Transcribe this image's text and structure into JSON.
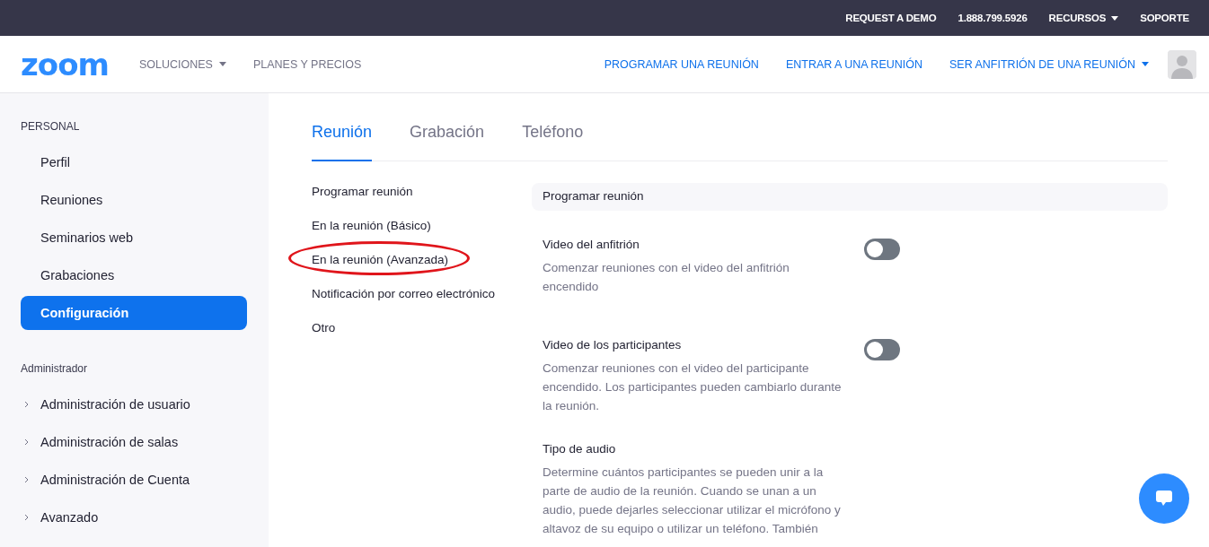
{
  "top_bar": {
    "links": [
      {
        "label": "REQUEST A DEMO",
        "kind": "link"
      },
      {
        "label": "1.888.799.5926",
        "kind": "link"
      },
      {
        "label": "RECURSOS",
        "kind": "dropdown"
      },
      {
        "label": "SOPORTE",
        "kind": "link"
      }
    ]
  },
  "header": {
    "logo": "zoom",
    "nav_left": [
      {
        "label": "SOLUCIONES",
        "kind": "dropdown"
      },
      {
        "label": "PLANES Y PRECIOS",
        "kind": "link"
      }
    ],
    "nav_right": [
      {
        "label": "PROGRAMAR UNA REUNIÓN",
        "kind": "link"
      },
      {
        "label": "ENTRAR A UNA REUNIÓN",
        "kind": "link"
      },
      {
        "label": "SER ANFITRIÓN DE UNA REUNIÓN",
        "kind": "dropdown"
      }
    ]
  },
  "sidebar": {
    "sections": [
      {
        "title": "PERSONAL",
        "items": [
          {
            "label": "Perfil",
            "selected": false,
            "expandable": false
          },
          {
            "label": "Reuniones",
            "selected": false,
            "expandable": false
          },
          {
            "label": "Seminarios web",
            "selected": false,
            "expandable": false
          },
          {
            "label": "Grabaciones",
            "selected": false,
            "expandable": false
          },
          {
            "label": "Configuración",
            "selected": true,
            "expandable": false
          }
        ]
      },
      {
        "title": "Administrador",
        "items": [
          {
            "label": "Administración de usuario",
            "selected": false,
            "expandable": true
          },
          {
            "label": "Administración de salas",
            "selected": false,
            "expandable": true
          },
          {
            "label": "Administración de Cuenta",
            "selected": false,
            "expandable": true
          },
          {
            "label": "Avanzado",
            "selected": false,
            "expandable": true
          }
        ]
      }
    ]
  },
  "tabs": [
    {
      "label": "Reunión",
      "selected": true
    },
    {
      "label": "Grabación",
      "selected": false
    },
    {
      "label": "Teléfono",
      "selected": false
    }
  ],
  "sub_nav": [
    {
      "label": "Programar reunión",
      "circled": false
    },
    {
      "label": "En la reunión (Básico)",
      "circled": false
    },
    {
      "label": "En la reunión (Avanzada)",
      "circled": true
    },
    {
      "label": "Notificación por correo electrónico",
      "circled": false
    },
    {
      "label": "Otro",
      "circled": false
    }
  ],
  "settings": {
    "section_title": "Programar reunión",
    "items": [
      {
        "title": "Video del anfitrión",
        "description": "Comenzar reuniones con el video del anfitrión encendido",
        "kind": "toggle",
        "on": false
      },
      {
        "title": "Video de los participantes",
        "description": "Comenzar reuniones con el video del participante encendido. Los participantes pueden cambiarlo durante la reunión.",
        "kind": "toggle",
        "on": false
      },
      {
        "title": "Tipo de audio",
        "description": "Determine cuántos participantes se pueden unir a la parte de audio de la reunión. Cuando se unan a un audio, puede dejarles seleccionar utilizar el micrófono y altavoz de su equipo o utilizar un teléfono. También",
        "kind": "text"
      }
    ]
  }
}
